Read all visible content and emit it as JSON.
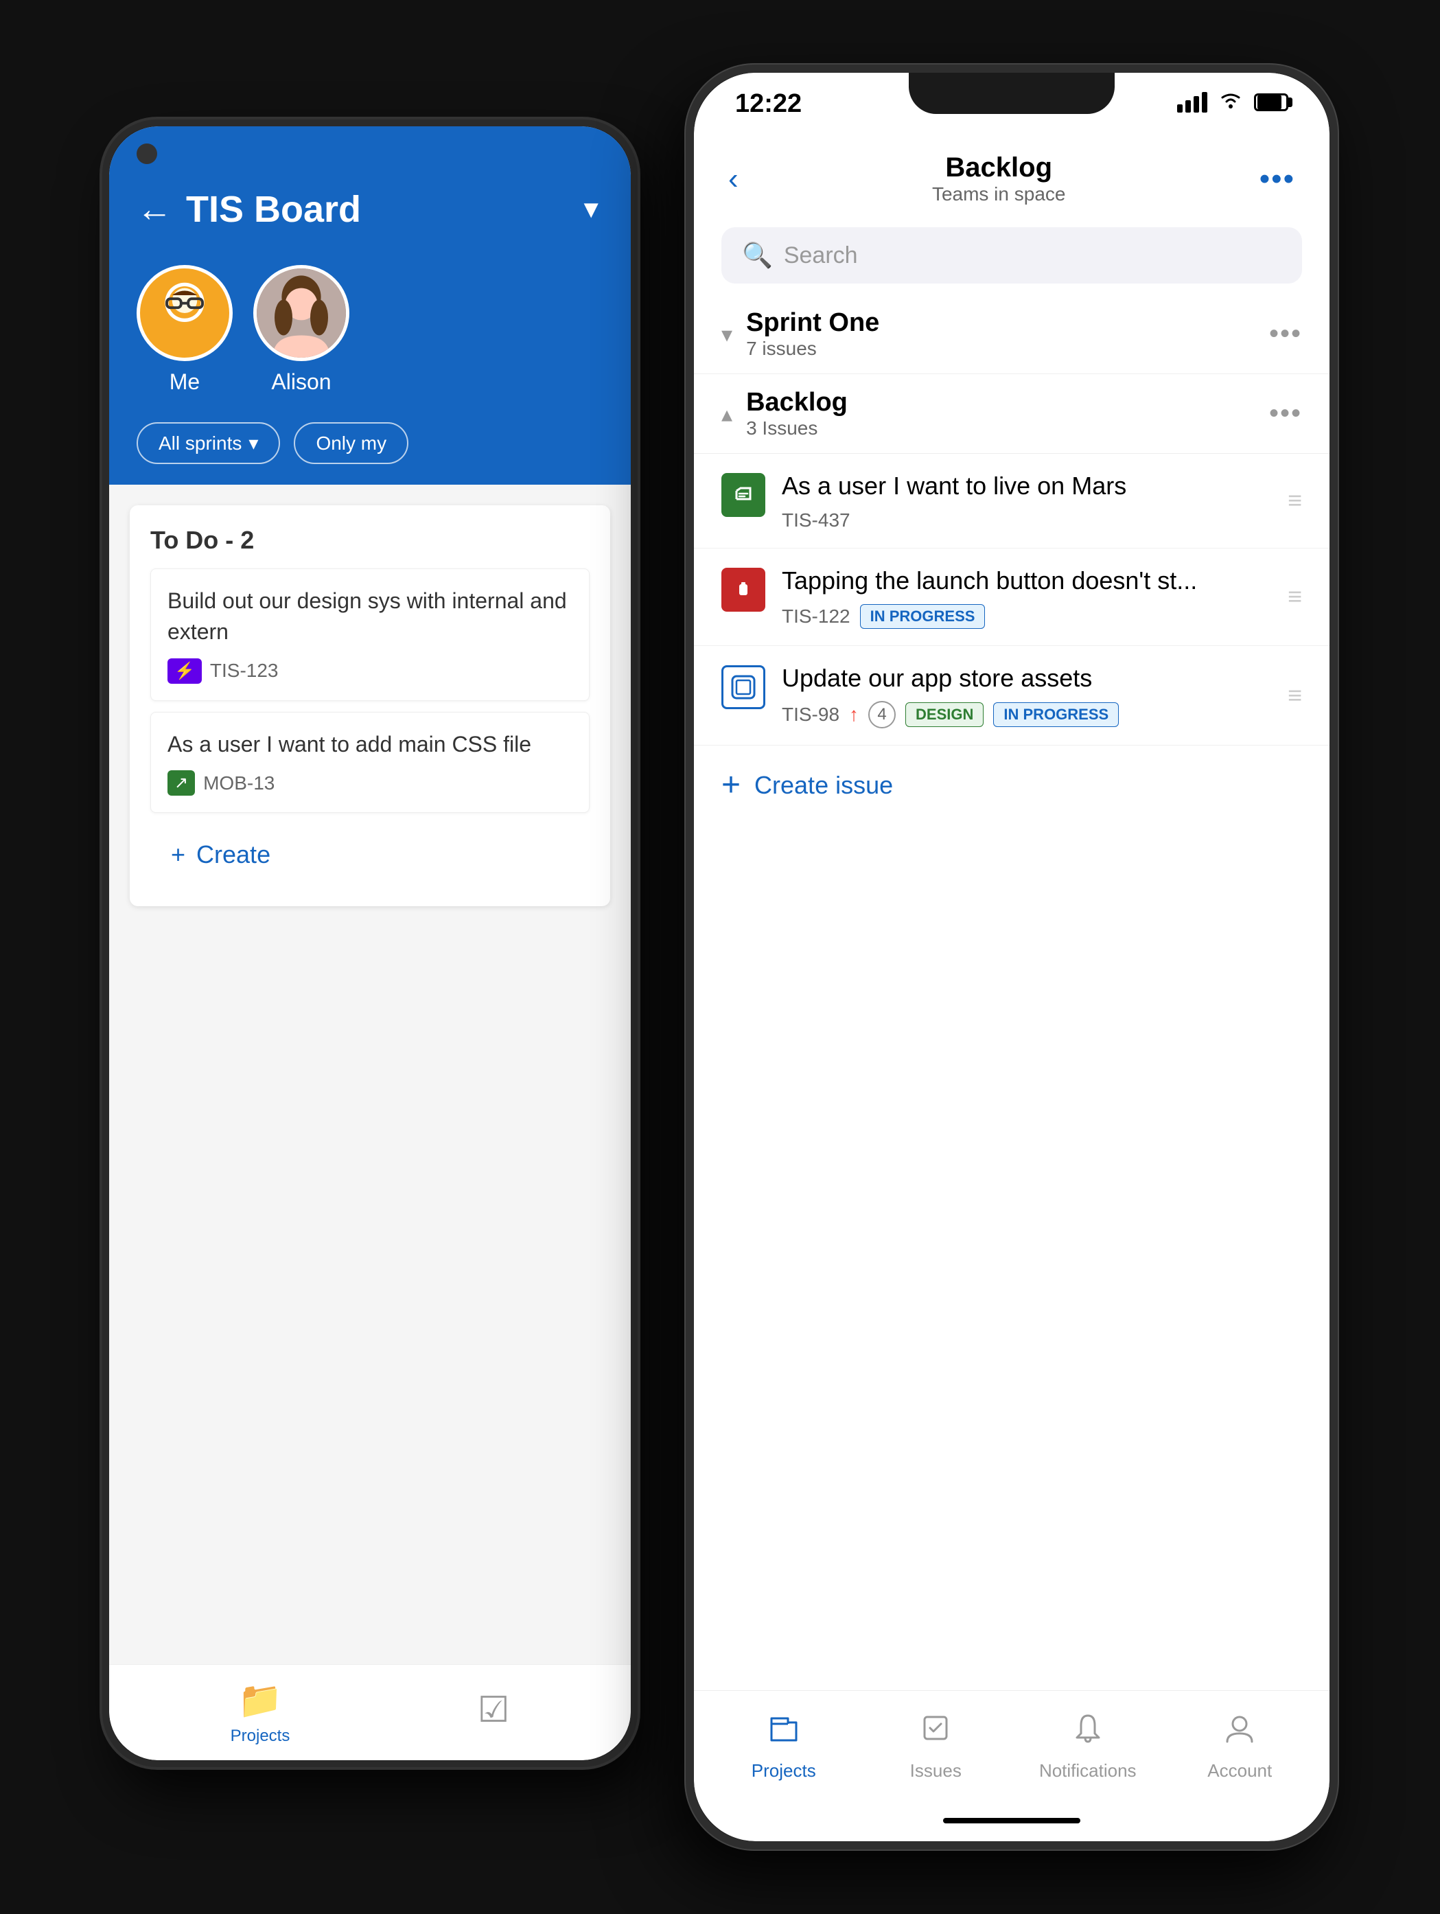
{
  "android": {
    "title": "TIS Board",
    "back_label": "←",
    "dropdown_arrow": "▼",
    "user1_label": "Me",
    "user2_label": "Alison",
    "filter1": "All sprints",
    "filter2": "Only my",
    "column_title": "To Do - 2",
    "card1_text": "Build out our design sys with internal and extern",
    "card1_id": "TIS-123",
    "card2_text": "As a user I want to add main CSS file",
    "card2_id": "MOB-13",
    "create_btn": "Create",
    "nav_projects": "Projects",
    "nav_issues": ""
  },
  "iphone": {
    "time": "12:22",
    "title": "Backlog",
    "subtitle": "Teams in space",
    "search_placeholder": "Search",
    "more_dots": "•••",
    "sprint_one_title": "Sprint One",
    "sprint_one_count": "7 issues",
    "backlog_title": "Backlog",
    "backlog_count": "3 Issues",
    "issue1_title": "As a user I want to live on Mars",
    "issue1_id": "TIS-437",
    "issue2_title": "Tapping the launch button doesn't st...",
    "issue2_id": "TIS-122",
    "issue2_badge": "IN PROGRESS",
    "issue3_title": "Update our app store assets",
    "issue3_id": "TIS-98",
    "issue3_story_points": "4",
    "issue3_badge_design": "DESIGN",
    "issue3_badge_progress": "IN PROGRESS",
    "create_issue": "Create issue",
    "nav_projects": "Projects",
    "nav_issues": "Issues",
    "nav_notifications": "Notifications",
    "nav_account": "Account"
  }
}
